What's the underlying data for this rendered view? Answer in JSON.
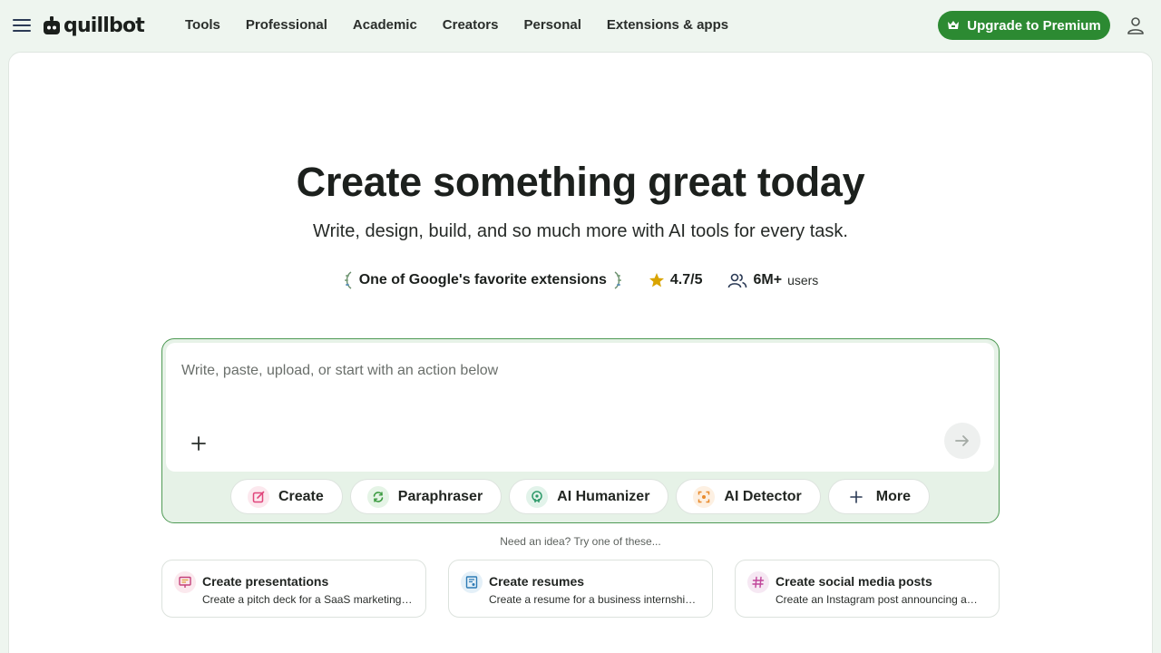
{
  "nav": {
    "logo_text": "quillbot",
    "items": [
      {
        "label": "Tools"
      },
      {
        "label": "Professional"
      },
      {
        "label": "Academic"
      },
      {
        "label": "Creators"
      },
      {
        "label": "Personal"
      },
      {
        "label": "Extensions & apps"
      }
    ],
    "upgrade_label": "Upgrade to Premium",
    "icons": [
      "menu-icon",
      "quillbot-logo-icon",
      "crown-icon",
      "account-icon"
    ]
  },
  "hero": {
    "title": "Create something great today",
    "subtitle": "Write, design, build, and so much more with AI tools for every task."
  },
  "stats": {
    "badge_label": "One of Google's favorite extensions",
    "rating_value": "4.7/5",
    "users_value": "6M+",
    "users_suffix": "users"
  },
  "prompt": {
    "placeholder": "Write, paste, upload, or start with an action below",
    "actions": [
      {
        "label": "Create",
        "icon": "create-icon"
      },
      {
        "label": "Paraphraser",
        "icon": "paraphraser-icon"
      },
      {
        "label": "AI Humanizer",
        "icon": "humanizer-icon"
      },
      {
        "label": "AI Detector",
        "icon": "detector-icon"
      },
      {
        "label": "More",
        "icon": "plus-icon"
      }
    ]
  },
  "ideas": {
    "label": "Need an idea? Try one of these...",
    "items": [
      {
        "title": "Create presentations",
        "desc": "Create a pitch deck for a SaaS marketing…",
        "icon": "presentation-icon"
      },
      {
        "title": "Create resumes",
        "desc": "Create a resume for a business internshi…",
        "icon": "resume-icon"
      },
      {
        "title": "Create social media posts",
        "desc": "Create an Instagram post announcing a…",
        "icon": "hashtag-icon"
      }
    ]
  },
  "colors": {
    "page_bg": "#eef5ef",
    "brand_green": "#2c8a32",
    "prompt_border": "#4f9a55",
    "star": "#d9a400"
  }
}
